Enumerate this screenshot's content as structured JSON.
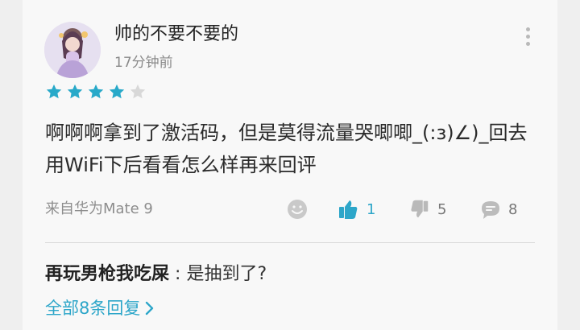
{
  "header": {
    "username": "帅的不要不要的",
    "time": "17分钟前"
  },
  "rating": {
    "value": 4,
    "max": 5,
    "filled_color": "#28a9c9",
    "empty_color": "#d8d8d8"
  },
  "comment": {
    "text": "啊啊啊拿到了激活码，但是莫得流量哭唧唧_(:з)∠)_回去用WiFi下后看看怎么样再来回评"
  },
  "meta": {
    "device": "来自华为Mate 9",
    "likes": "1",
    "dislikes": "5",
    "comments": "8"
  },
  "reply": {
    "author": "再玩男枪我吃屎",
    "separator": ":",
    "text": "是抽到了?",
    "link": "全部8条回复"
  },
  "colors": {
    "accent": "#2da6c9",
    "background": "#f8f8f8",
    "muted_icon": "#bcbcbc"
  },
  "icons": {
    "more": "more-vertical-icon",
    "emoji": "emoji-icon",
    "like": "thumbs-up-icon",
    "dislike": "thumbs-down-icon",
    "comment": "comment-icon",
    "chevron": "chevron-right-icon"
  }
}
